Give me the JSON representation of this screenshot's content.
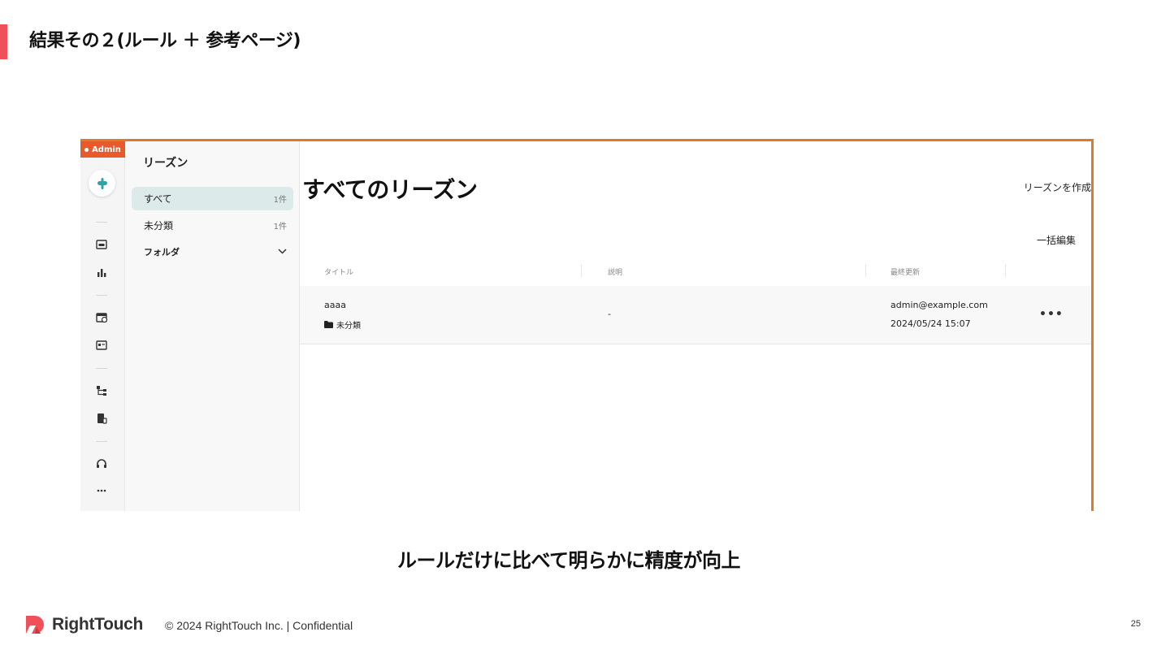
{
  "slide": {
    "title": "結果その２(ルール ＋ 参考ページ)",
    "caption": "ルールだけに比べて明らかに精度が向上",
    "page_number": "25",
    "accent_color": "#f0505a"
  },
  "footer": {
    "brand": "RightTouch",
    "copyright": "© 2024 RightTouch Inc.  |  Confidential"
  },
  "app": {
    "badge": "Admin",
    "badge_color": "#e8592b",
    "frame_color": "#e07a2a",
    "rail_icons": [
      "logo-icon",
      "inbox-icon",
      "bar-chart-icon",
      "calendar-icon",
      "card-icon",
      "tree-icon",
      "document-icon",
      "headset-icon",
      "more-icon"
    ],
    "sidebar": {
      "title": "リーズン",
      "items": [
        {
          "label": "すべて",
          "count": "1件",
          "active": true
        },
        {
          "label": "未分類",
          "count": "1件",
          "active": false
        }
      ],
      "folder_label": "フォルダ"
    },
    "main": {
      "title": "すべてのリーズン",
      "create_button": "リーズンを作成",
      "bulk_edit_button": "一括編集",
      "columns": [
        "タイトル",
        "説明",
        "最終更新"
      ],
      "rows": [
        {
          "title": "aaaa",
          "folder": "未分類",
          "description": "-",
          "updated_by": "admin@example.com",
          "updated_at": "2024/05/24 15:07"
        }
      ]
    }
  }
}
